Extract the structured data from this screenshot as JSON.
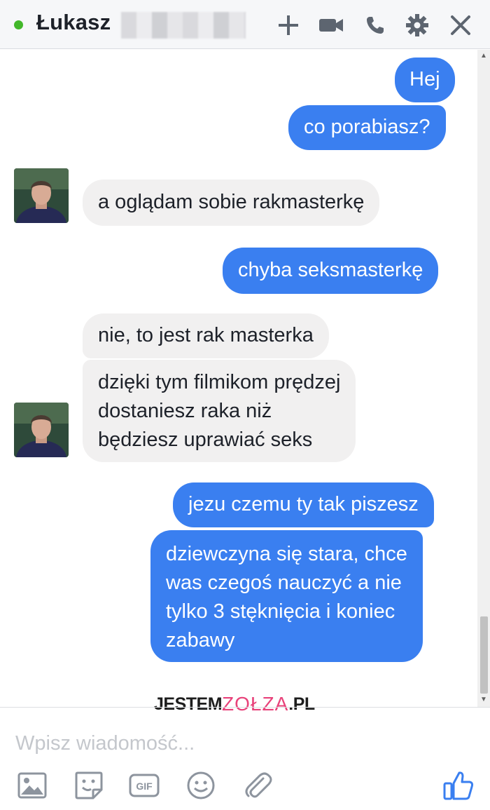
{
  "header": {
    "contact_name": "Łukasz",
    "status_color": "#42b72a",
    "icons": [
      "add-person-icon",
      "video-call-icon",
      "phone-icon",
      "gear-icon",
      "close-icon"
    ]
  },
  "messages": [
    {
      "side": "out",
      "text": "Hej"
    },
    {
      "side": "out",
      "text": "co porabiasz?"
    },
    {
      "side": "in",
      "text": "a oglądam sobie rakmasterkę"
    },
    {
      "side": "out",
      "text": "chyba seksmasterkę"
    },
    {
      "side": "in",
      "text": "nie, to jest rak masterka"
    },
    {
      "side": "in",
      "lines": [
        "dzięki tym filmikom prędzej",
        "dostaniesz raka niż",
        "będziesz uprawiać seks"
      ]
    },
    {
      "side": "out",
      "text": "jezu czemu ty tak piszesz"
    },
    {
      "side": "out",
      "lines": [
        "dziewczyna się stara, chce",
        "was czegoś nauczyć a nie",
        "tylko 3 stęknięcia i koniec",
        "zabawy"
      ]
    }
  ],
  "watermark": {
    "part1": "JESTEM",
    "part2": "ZOŁZA",
    "part3": ".PL",
    "accent": "#e8427a"
  },
  "composer": {
    "placeholder": "Wpisz wiadomość...",
    "tools": [
      "photo-icon",
      "sticker-icon",
      "gif-icon",
      "emoji-icon",
      "attachment-icon"
    ],
    "gif_label": "GIF",
    "like_color": "#3a7ff0"
  },
  "colors": {
    "outgoing": "#3a7ff0",
    "incoming": "#f1f0f0"
  }
}
